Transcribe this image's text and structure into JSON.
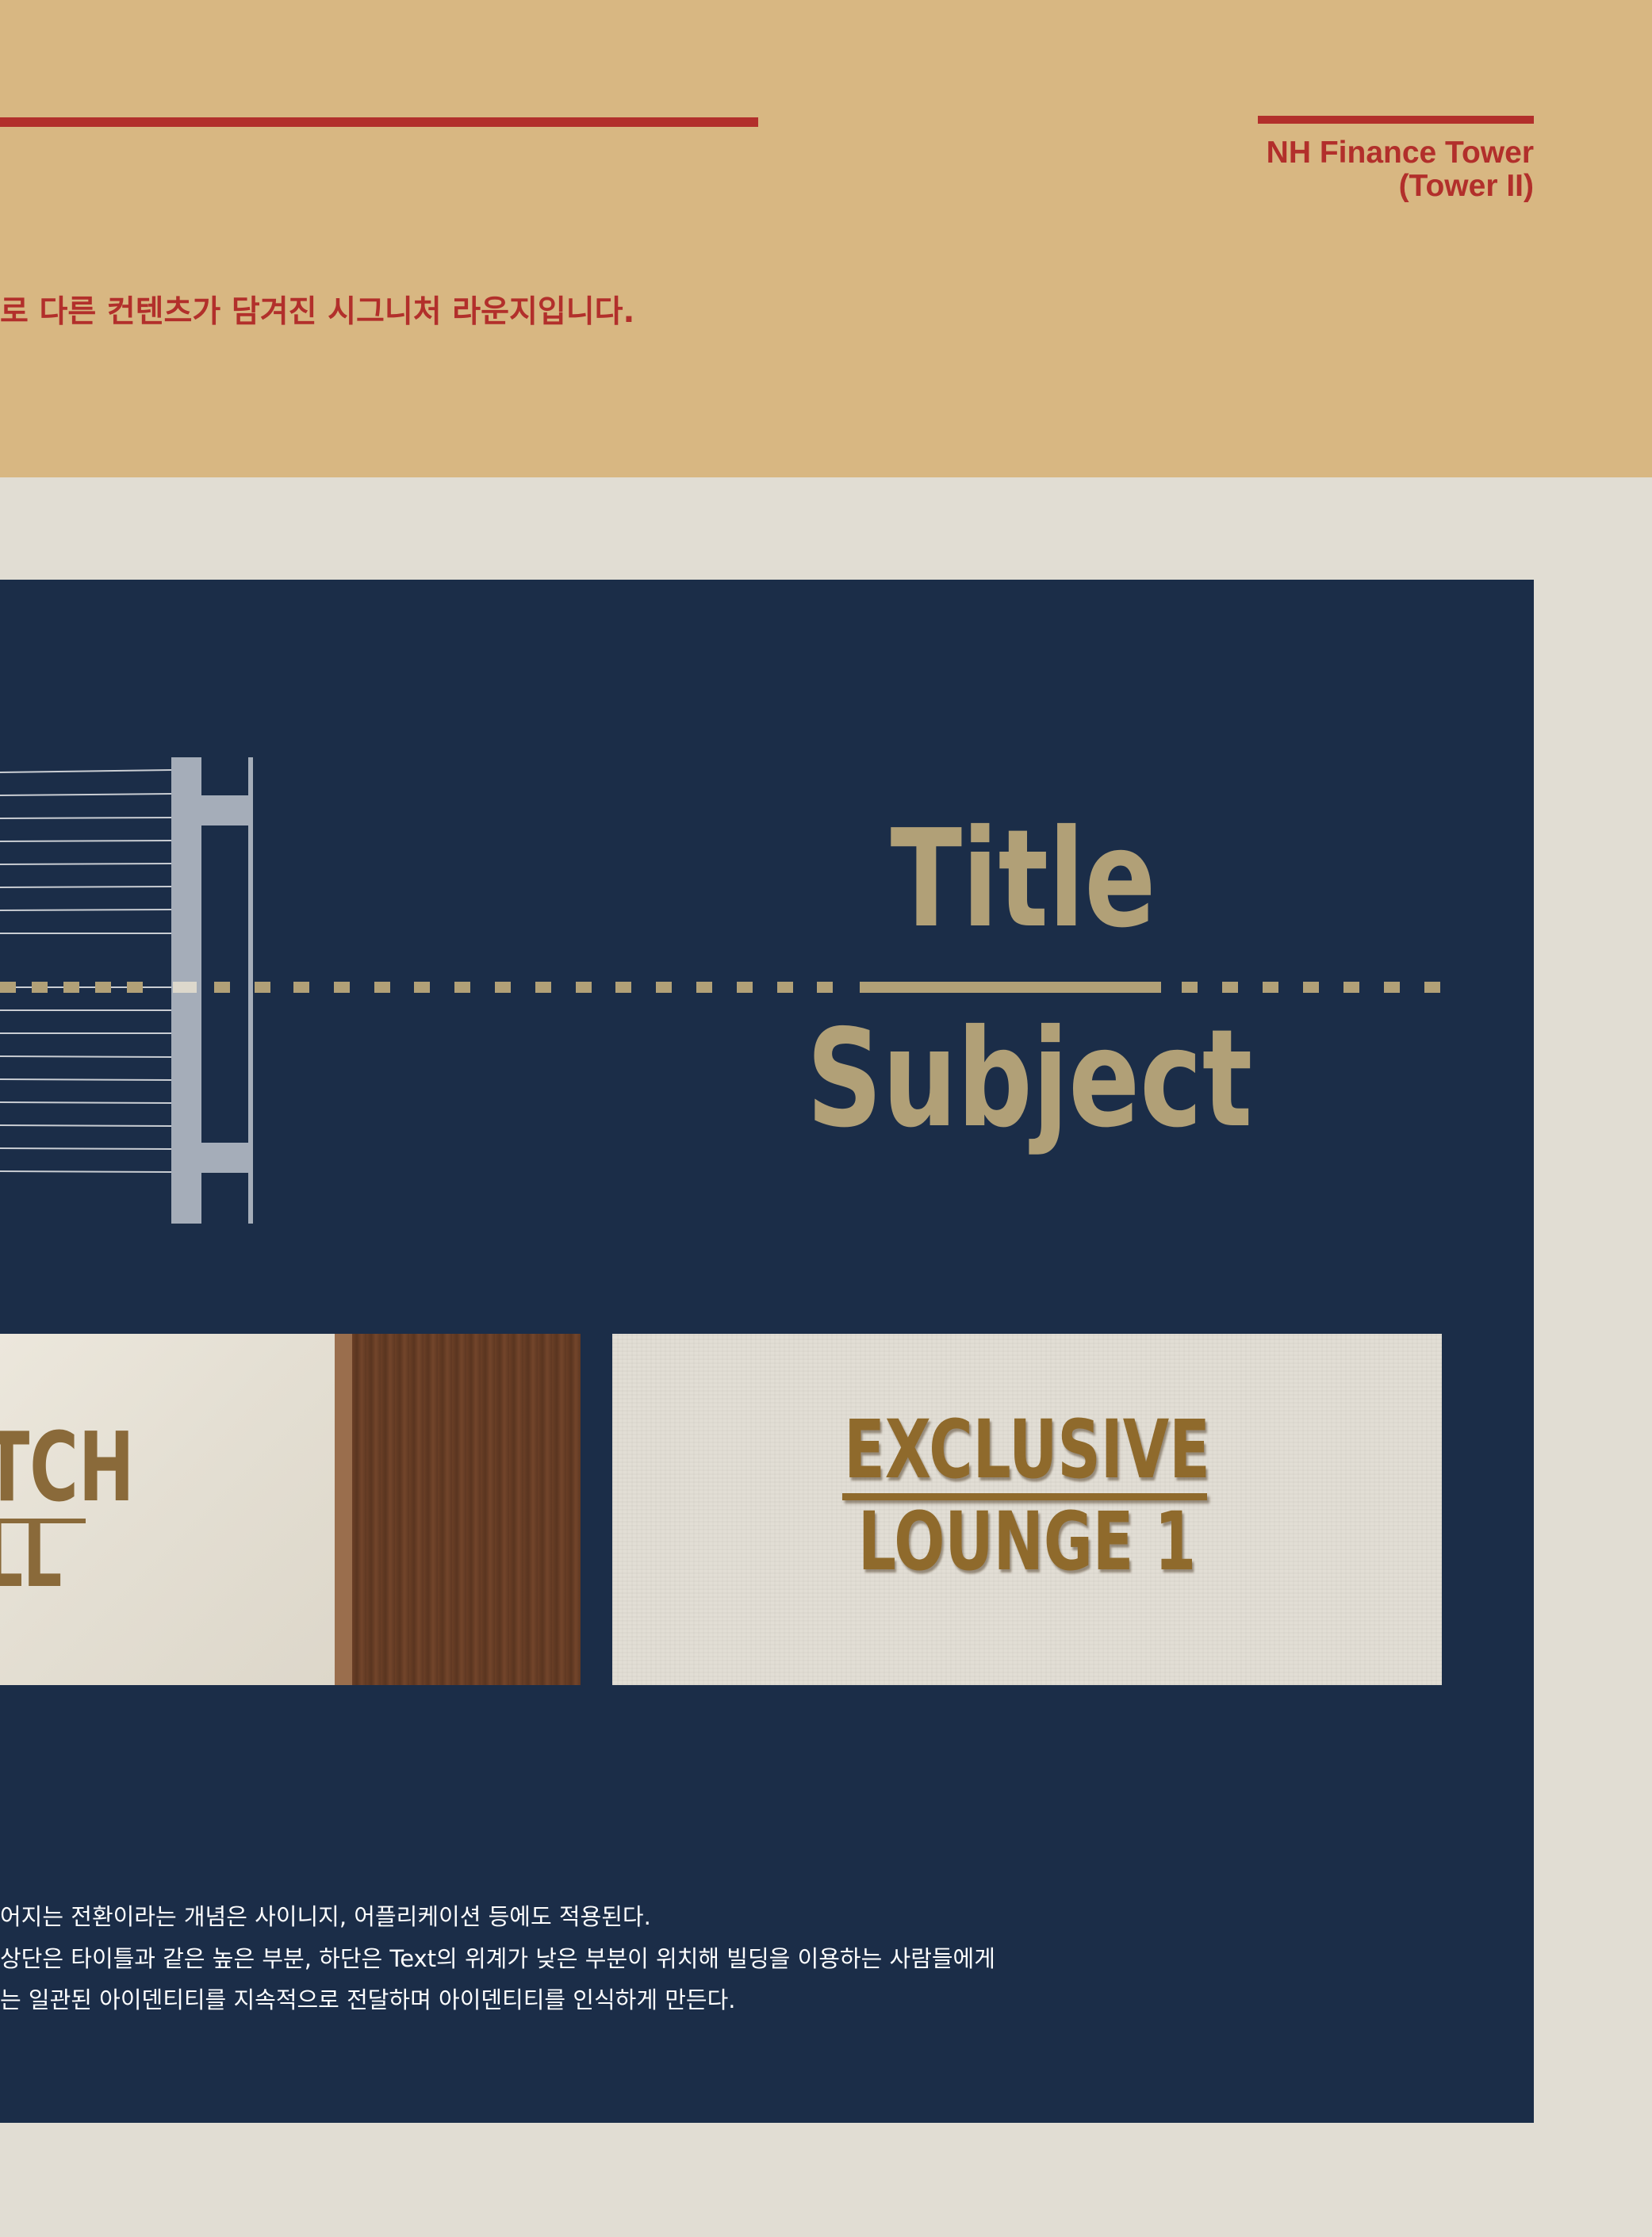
{
  "header": {
    "brand_name": "NH Finance Tower",
    "brand_sub": "(Tower II)",
    "intro_text": "로 다른 컨텐츠가 담겨진 시그니처 라운지입니다."
  },
  "diagram": {
    "title": "Title",
    "subject": "Subject"
  },
  "photos": {
    "left_sign_line_1": "TCH",
    "left_sign_line_2": "LL",
    "right_sign_line_1": "EXCLUSIVE",
    "right_sign_line_2": "LOUNGE 1"
  },
  "body": {
    "line_1": "어지는 전환이라는 개념은 사이니지, 어플리케이션 등에도 적용된다.",
    "line_2": "상단은 타이틀과 같은 높은 부분, 하단은 Text의 위계가 낮은 부분이 위치해 빌딩을 이용하는 사람들에게",
    "line_3": "는 일관된 아이덴티티를 지속적으로 전달하며 아이덴티티를 인식하게 만든다."
  },
  "colors": {
    "header_bg": "#d8b782",
    "accent_red": "#b22f2b",
    "panel_navy": "#1b2d48",
    "gold_text": "#b1a077",
    "page_bg": "#e1ddd3"
  }
}
